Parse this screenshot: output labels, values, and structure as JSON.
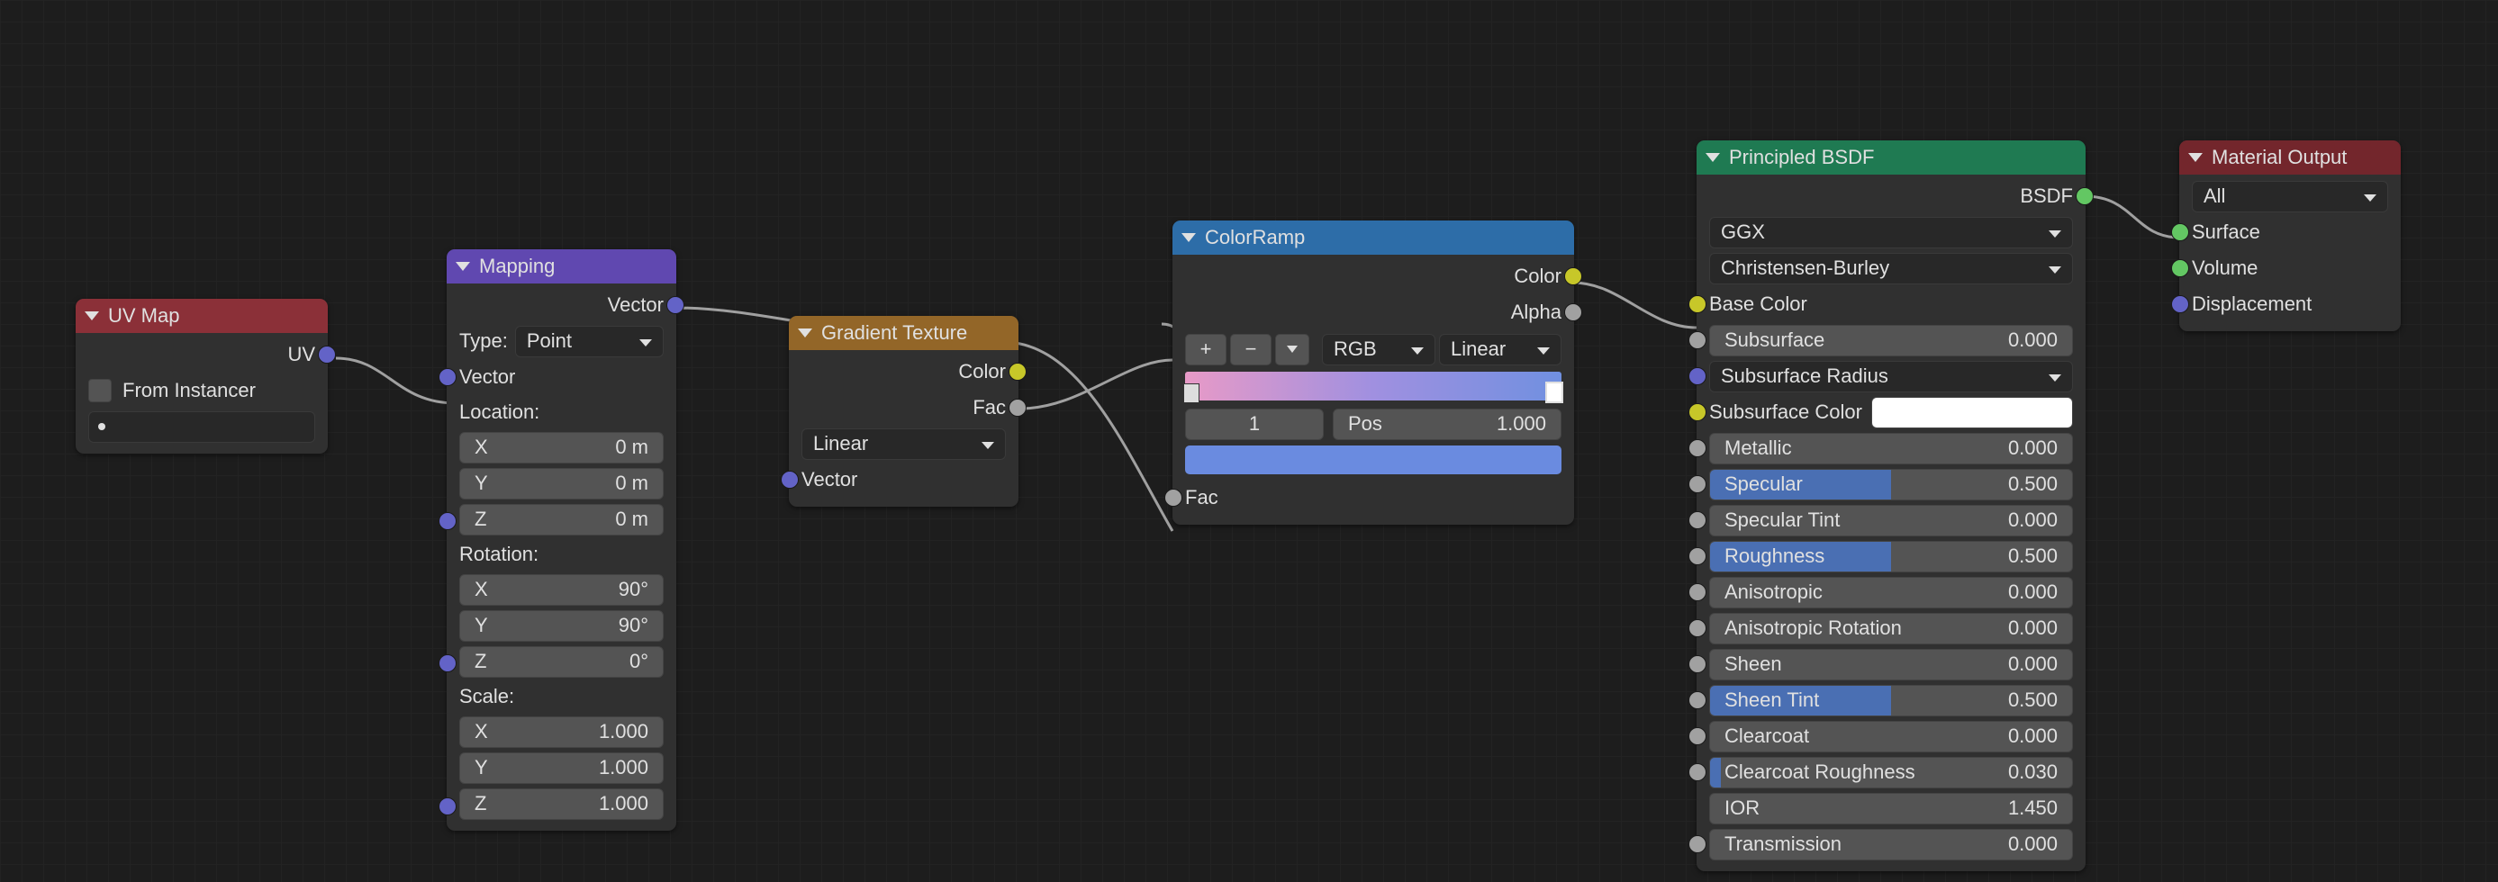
{
  "uvmap": {
    "title": "UV Map",
    "out_uv": "UV",
    "from_instancer": "From Instancer",
    "map_value": ""
  },
  "mapping": {
    "title": "Mapping",
    "out_vector": "Vector",
    "type_label": "Type:",
    "type_value": "Point",
    "in_vector": "Vector",
    "loc_label": "Location:",
    "loc": {
      "x": {
        "k": "X",
        "v": "0 m"
      },
      "y": {
        "k": "Y",
        "v": "0 m"
      },
      "z": {
        "k": "Z",
        "v": "0 m"
      }
    },
    "rot_label": "Rotation:",
    "rot": {
      "x": {
        "k": "X",
        "v": "90°"
      },
      "y": {
        "k": "Y",
        "v": "90°"
      },
      "z": {
        "k": "Z",
        "v": "0°"
      }
    },
    "scale_label": "Scale:",
    "scale": {
      "x": {
        "k": "X",
        "v": "1.000"
      },
      "y": {
        "k": "Y",
        "v": "1.000"
      },
      "z": {
        "k": "Z",
        "v": "1.000"
      }
    }
  },
  "gradient": {
    "title": "Gradient Texture",
    "out_color": "Color",
    "out_fac": "Fac",
    "type": "Linear",
    "in_vector": "Vector"
  },
  "colorramp": {
    "title": "ColorRamp",
    "out_color": "Color",
    "out_alpha": "Alpha",
    "btn_add": "+",
    "btn_del": "−",
    "mode": "RGB",
    "interp": "Linear",
    "idx": "1",
    "pos_label": "Pos",
    "pos_val": "1.000",
    "in_fac": "Fac"
  },
  "bsdf": {
    "title": "Principled BSDF",
    "out": "BSDF",
    "dist": "GGX",
    "sss_method": "Christensen-Burley",
    "params": [
      {
        "name": "Base Color",
        "kind": "colorsock"
      },
      {
        "name": "Subsurface",
        "kind": "num",
        "val": "0.000"
      },
      {
        "name": "Subsurface Radius",
        "kind": "dropvec"
      },
      {
        "name": "Subsurface Color",
        "kind": "swatch"
      },
      {
        "name": "Metallic",
        "kind": "num",
        "val": "0.000"
      },
      {
        "name": "Specular",
        "kind": "num",
        "val": "0.500",
        "fill": 50
      },
      {
        "name": "Specular Tint",
        "kind": "num",
        "val": "0.000"
      },
      {
        "name": "Roughness",
        "kind": "num",
        "val": "0.500",
        "fill": 50
      },
      {
        "name": "Anisotropic",
        "kind": "num",
        "val": "0.000"
      },
      {
        "name": "Anisotropic Rotation",
        "kind": "num",
        "val": "0.000"
      },
      {
        "name": "Sheen",
        "kind": "num",
        "val": "0.000"
      },
      {
        "name": "Sheen Tint",
        "kind": "num",
        "val": "0.500",
        "fill": 50
      },
      {
        "name": "Clearcoat",
        "kind": "num",
        "val": "0.000"
      },
      {
        "name": "Clearcoat Roughness",
        "kind": "num",
        "val": "0.030",
        "fill": 3
      },
      {
        "name": "IOR",
        "kind": "numplain",
        "val": "1.450"
      },
      {
        "name": "Transmission",
        "kind": "num",
        "val": "0.000"
      }
    ]
  },
  "output": {
    "title": "Material Output",
    "target": "All",
    "surface": "Surface",
    "volume": "Volume",
    "displacement": "Displacement"
  }
}
